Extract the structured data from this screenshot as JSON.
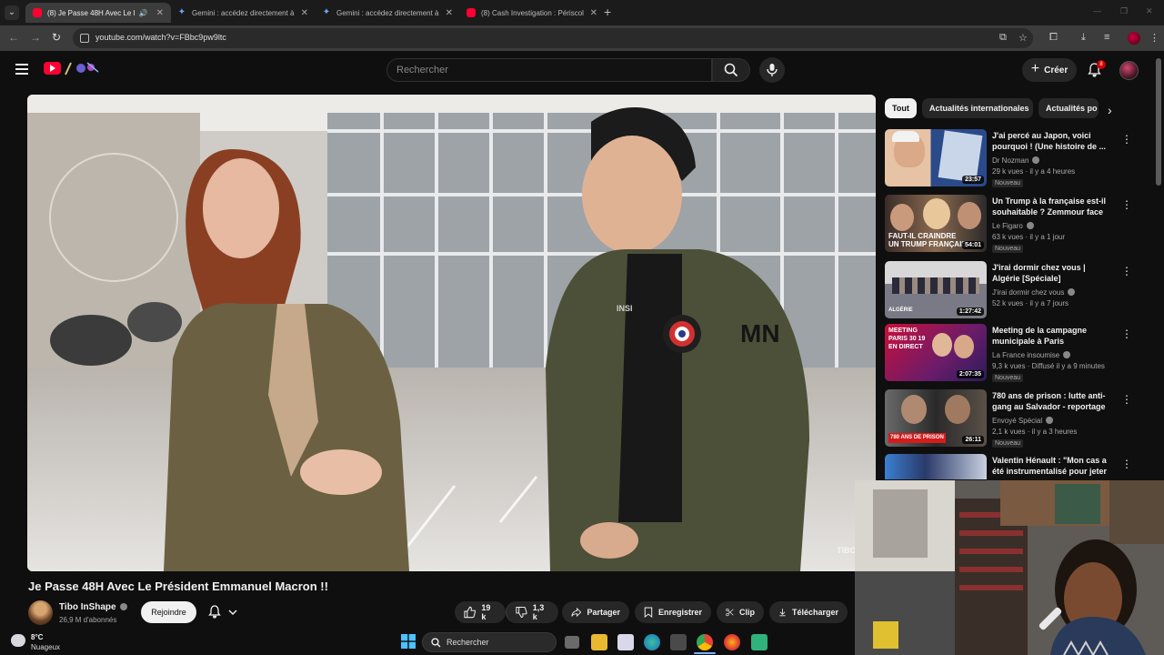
{
  "browser": {
    "tabs": [
      {
        "title": "(8) Je Passe 48H Avec Le Pr",
        "icon": "youtube-icon",
        "audio": true,
        "active": true
      },
      {
        "title": "Gemini : accédez directement à",
        "icon": "gemini-icon",
        "active": false
      },
      {
        "title": "Gemini : accédez directement à",
        "icon": "gemini-icon",
        "active": false
      },
      {
        "title": "(8) Cash Investigation : Périscol",
        "icon": "youtube-icon",
        "active": false
      }
    ],
    "url": "youtube.com/watch?v=FBbc9pw9ltc"
  },
  "youtube": {
    "search_placeholder": "Rechercher",
    "create_label": "Créer",
    "notifications_count": "8"
  },
  "video": {
    "title": "Je Passe 48H Avec Le Président Emmanuel Macron !!",
    "channel": "Tibo InShape",
    "subscribers": "26,9 M d'abonnés",
    "join_label": "Rejoindre",
    "likes": "19 k",
    "dislikes": "1,3 k",
    "share_label": "Partager",
    "save_label": "Enregistrer",
    "clip_label": "Clip",
    "download_label": "Télécharger",
    "overlay_text": {
      "patch": "MN",
      "chest": "INSI",
      "watermark": "TIBO"
    }
  },
  "sidebar": {
    "chips": [
      "Tout",
      "Actualités internationales",
      "Actualités po"
    ],
    "recommendations": [
      {
        "title": "J'ai percé au Japon, voici pourquoi ! (Une histoire de ...",
        "channel": "Dr Nozman",
        "verified": true,
        "meta": "29 k vues · il y a 4 heures",
        "badge": "Nouveau",
        "duration": "23:57",
        "caption": ""
      },
      {
        "title": "Un Trump à la française est-il souhaitable ? Zemmour face à...",
        "channel": "Le Figaro",
        "verified": true,
        "meta": "63 k vues · il y a 1 jour",
        "badge": "Nouveau",
        "duration": "54:01",
        "caption": "FAUT-IL CRAINDRE UN TRUMP FRANÇAIS"
      },
      {
        "title": "J'irai dormir chez vous | Algérie [Spéciale]",
        "channel": "J'irai dormir chez vous",
        "verified": true,
        "meta": "52 k vues · il y a 7 jours",
        "badge": "",
        "duration": "1:27:42",
        "caption": "ALGÉRIE"
      },
      {
        "title": "Meeting de la campagne municipale à Paris",
        "channel": "La France insoumise",
        "verified": true,
        "meta": "9,3 k vues · Diffusé il y a 9 minutes",
        "badge": "Nouveau",
        "duration": "2:07:35",
        "caption": "MEETING PARIS 30 19 EN DIRECT"
      },
      {
        "title": "780 ans de prison : lutte anti-gang au Salvador - reportage ...",
        "channel": "Envoyé Spécial",
        "verified": true,
        "meta": "2,1 k vues · il y a 3 heures",
        "badge": "Nouveau",
        "duration": "26:11",
        "caption": "780 ANS DE PRISON"
      },
      {
        "title": "Valentin Hénault : \"Mon cas a été instrumentalisé pour jeter l...",
        "channel": "",
        "verified": false,
        "meta": "",
        "badge": "",
        "duration": "",
        "caption": ""
      }
    ]
  },
  "taskbar": {
    "weather_temp": "8°C",
    "weather_cond": "Nuageux",
    "search_label": "Rechercher"
  },
  "colors": {
    "youtube_red": "#ff0033",
    "background": "#0f0f0f",
    "chip": "#272727"
  }
}
